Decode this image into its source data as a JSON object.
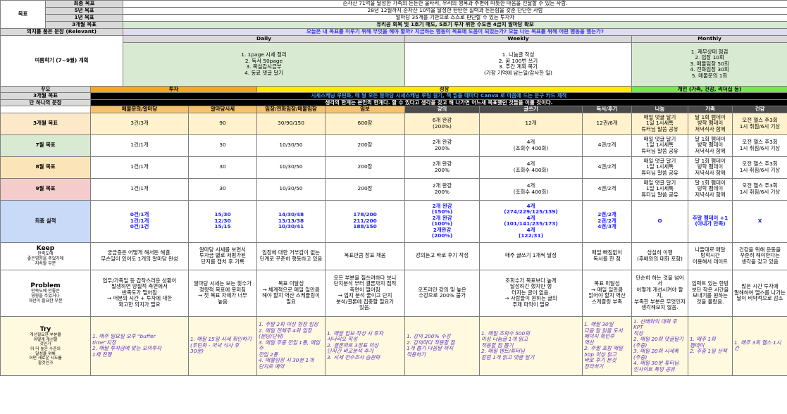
{
  "goals": {
    "section_label": "목표",
    "rows": [
      {
        "label": "최종 목표",
        "text": "순자산 71억을 달성한 가족의 든든한 울타리, 우리의 행복과 주변에 따뜻한 마음을 전달할 수 있는 사람."
      },
      {
        "label": "5년 목표",
        "text": "28년 12월까지 순자산 10억을 달성한 탄탄한 실력과 든든함을 갖춘 단단한 사람"
      },
      {
        "label": "1년 목표",
        "text": "알마당 35개를 기반으로 스스로 판단할 수 있는 투자자"
      },
      {
        "label": "3개월 목표",
        "text": "유리공 회복 및 1호기 매도, 5호기 투자 위한 수도권 4급지 알마당 확보"
      },
      {
        "label": "의지를 품은 문장 (Relevant)",
        "text": "오늘은 내 목표를 이루기 위해 무엇을 해야 할까? 지금하는 행동이 목표에 도움이 되었는가? 오늘 나는 목표를 위해 어떤 행동을 했는가?"
      }
    ]
  },
  "plan": {
    "label": "여름학기 (7~9월) 계획",
    "daily": {
      "title": "Daily",
      "items": [
        "1. 1page 시세 정리",
        "2. 독서 50page",
        "3. 목실감시금부",
        "4. 동료 댓글 달기"
      ]
    },
    "weekly": {
      "title": "Weekly",
      "items": [
        "1. 나눔글 작성",
        "2. 꿈 100번 쓰기",
        "3. 주간 계획 복기",
        "(가장 기억에 남는일/감사한 일)"
      ]
    },
    "monthly": {
      "title": "Monthly",
      "items": [
        "1. 재무상태 점검",
        "2. 임장 10회",
        "3. 매물임장 50회",
        "4. 전화임장 30회",
        "5. 매물문의 1회"
      ]
    }
  },
  "dream": {
    "label": "꾸오",
    "invest": "투자",
    "growth": "성장",
    "personal": "개인 (가족, 건강, 리더십 등)",
    "goal3_label": "3개월 목표",
    "goal3_text": "시세스케닝 루틴화, 매 달 모든 알마당 시세스캐닝 루팅 걸기, 책 읽을 때마다 Canva 로 마음에 드는 문구 카드 제작",
    "one_label": "단 하나의 문장",
    "one_text": "생각의 한계는 본인의 한계다. 할 수 있다고 생각을 갖고 해 나가면 어느새 목표했던 것들을 이룰 것이다."
  },
  "columns": [
    "매물문의/알마당",
    "알마당시세",
    "임장/전화임장/매물임장",
    "임보",
    "강의",
    "글쓰기",
    "독서/후기",
    "나눔",
    "가족",
    "건강"
  ],
  "rows": [
    {
      "label": "3개월 목표",
      "cells": [
        "3건/3개",
        "90",
        "30/90/150",
        "600장",
        "6개 완강\n(200%)",
        "12개",
        "12권/6개",
        "매일 댓글 달기\n1일 1시세톡\n튜터님 말씀 공유",
        "달 1회 펨데이\n방학 펨데이\n저녁식사 함께",
        "오전 헬스 주3회\n1시 취침/6시 기상"
      ]
    },
    {
      "label": "7월 목표",
      "cells": [
        "1건/1개",
        "30",
        "10/30/50",
        "200장",
        "2개 완강\n200%",
        "4개\n(조회수 400회)",
        "4권/2개",
        "매일 댓글 달기\n1일 1시세톡\n튜터님 말씀 공유",
        "달 1회 펨데이\n방학 펨데이\n저녁식사 함께",
        "오전 헬스 주3회\n1시 취침/6시 기상"
      ]
    },
    {
      "label": "8월 목표",
      "cells": [
        "1건/1개",
        "30",
        "10/30/50",
        "200장",
        "2개 완강\n200%",
        "4개\n(조회수 400회)",
        "4권/2개",
        "매일 댓글 달기\n1일 1시세톡\n튜터님 말씀 공유",
        "달 1회 펨데이\n방학 펨데이\n저녁식사 함께",
        "오전 헬스 주3회\n1시 취침/6시 기상"
      ]
    },
    {
      "label": "9월 목표",
      "cells": [
        "1건/1개",
        "30",
        "10/30/50",
        "200장",
        "2개 완강\n200%",
        "4개\n(조회수 400회)",
        "4권/2개",
        "매일 댓글 달기\n1일 1시세톡\n튜터님 말씀 공유",
        "달 1회 펨데이\n방학 펨데이\n저녁식사 함께",
        "오전 헬스 주3회\n1시 취침/6시 기상"
      ]
    }
  ],
  "result": {
    "label": "최종 실적",
    "cells": [
      "0건/1개\n1건/1개\n0건/1건",
      "15/30\n12/30\n15/15",
      "14/30/48\n13/13/38\n10/30/41",
      "178/200\n211/200\n188/150",
      "2개 완강\n(150%)\n2개 완강\n(100%)\n2개완강\n(200%)",
      "4개\n(274/229/125/139)\n4개\n(101/141/235/173)\n4개\n(122/31)",
      "2권/2개\n2권/2개\n4권/3개",
      "O",
      "주말 펨데이 +1\n(아내가 만족)",
      "X"
    ]
  },
  "keep": {
    "label": "Keep",
    "sub": "만족도에\n좋은영향을 주었거에\n지속할 부분",
    "cells": [
      "궁금증은 어떻게 해서든 해결.\n무슨일이 있어도 1개의 알마당 완성",
      "알마당 시세를 보면서\n투자금 별로 저평가된\n단지를 캡처 후 기록",
      "임장에 대한 거부감이 없는\n단계로 꾸준히 행동하고 있음",
      "목표만큼 장표 채움",
      "강의듣고 바로 후기 작성",
      "매주 글쓰기 1개씩 달성",
      "매일 빠짐없이\n독서를 한 점",
      "성실히 이행\n(후배와의 대화 포함)",
      "나들대로 매달\n방학시간\n이용해서 데이트",
      "건강을 위해 운동을\n꾸준히 해야한다는\n생각을 갖고 있음"
    ]
  },
  "problem": {
    "label": "Problem",
    "sub": "만족도에 안좋은\n영향을 주었거나\n개선이 필요한 부분",
    "cells": [
      "업무/가족일 등 갑작스러운 상황이\n발생하면 양질적 측면에서\n반족도가 떨어짐\n→ 어분의 시간 + 투자에 대한\n확고한 의지가 필요",
      "알마당 시세는 보는 횟수가\n정량적 목표에 못미침\n→ 첫 목표 자체가 너무\n높음",
      "목표 미달성\n→ 체계적으로 매일 일만큼\n해야 할지 역산 스케쥴링이\n필요",
      "모든 부분을 질쓰려하다 보니\n단지분석 부터 결론까지 집적\n측면이 떨어짐\n→ 입지 분석 줄이고 단지\n분석/결론에 집중할 필요가\n있음.",
      "오프라인 강의 및 높은\n수강으로 200% 불가",
      "조회수가 목표보다 높게\n달성하긴 했지만 행\n터지는 글이 없음.\n→ 사람들이 원하는 글의\n주제 파악이 필요",
      "목표 미달성\n→ 매일 일만큼\n읽어야 할지 역산\n스케쥴링 부족",
      "단순히 하는 것을 넘어서\n어떻게 개선시켜야 할지,\n부족한 부분은 무엇인지\n생각해보지 않음.",
      "입력트 있는 한방\n보단 작은 시간을\n보내기를 원하는\n것을 몰랐음.",
      "많은 시간 투자에\n말해하여 앨스를 나가는\n날이 비약적으로 감소"
    ]
  },
  "try": {
    "label": "Try",
    "sub": "개선필요한 부분을\n어떻게 개선할\n것인가\n이 더 높은 수준의\n달성을 위해\n어떤 새로운 시도를\n할것인가",
    "cells": [
      "1. 매주 일요일 오후 \"buffer\ntime\"지정\n2. 매달 투자금에 맞는 모의투자\n1채 진행",
      "1. 매달 15일 시세 확인하기\n(루틴화 - 저녁 식사 후\n30분)",
      "1. 주말 2회 이상 현장 임장\n2. 매일 전체주 4회 임장\n(분당/단위)\n3. 매일 주중 전임 1통, 매임주\n전임 2통\n4. 매물임장 시 30분 1개\n단지로 예약",
      "1. 매달 입보 작성 시 투자\n시나리오 작성\n2. 결론파트 3장표 이상\n단지간 비교분석 추가\n3. 시세 전수조사 습관화",
      "1. 강의 200% 수강\n2. 강의마다 적용할 점\n1개 뽑기 다음달 까지\n적용하기",
      "1. 매일 조회수 500회\n이상 나눔글 1개 읽고\n적용할 점 뽑기\n2. 매일 멘트/튜터님\n칼럼 1개 읽고 댓글 달기",
      "1. 매달 30일\n다음 달 읽을 도서\n페이지 확인후\n역산\n2. 주말 포함 매일\n50p 이상 읽고\n바로 후기 본것\n정리하기",
      "1. 선배와의 대화 후 KPT\n작성\n2. 매일 20회 댓글달기\n(주중)\n3. 매일 20회 시세톡 (주중)\n4. 매일 30분 튜터님\n인사이트 특방 공유",
      "1. 매주 1회\n펨데이\n2. 주중 1일 산책",
      "1. 매주 3회 헬스 1시간"
    ]
  }
}
